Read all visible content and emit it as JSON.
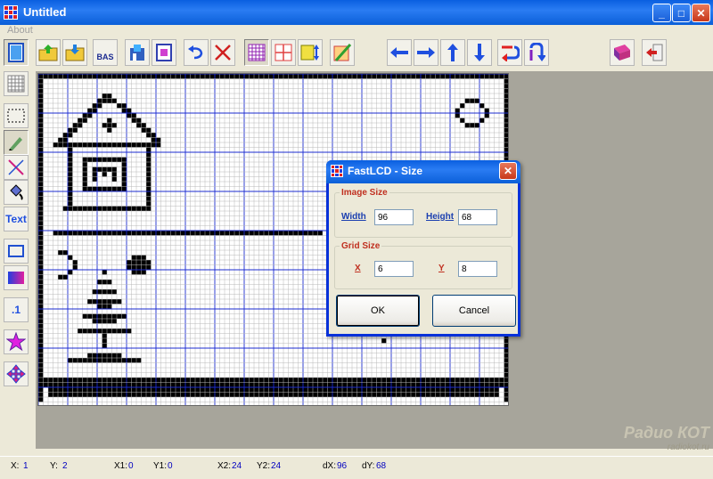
{
  "window": {
    "title": "Untitled",
    "minimize": "_",
    "maximize": "□",
    "close": "✕"
  },
  "menu": {
    "about": "About"
  },
  "toolbar": {
    "new": "new-file-icon",
    "open": "open-folder-icon",
    "save": "save-folder-icon",
    "export_bas": "BAS",
    "import": "import-icon",
    "export": "export-icon",
    "undo": "undo-icon",
    "clear": "clear-icon",
    "grid": "grid-icon",
    "grid2": "grid-lines-icon",
    "resize": "resize-icon",
    "paint": "paint-icon",
    "shift_left": "arrow-left-icon",
    "shift_right": "arrow-right-icon",
    "shift_up": "arrow-up-icon",
    "shift_down": "arrow-down-icon",
    "flip_h": "flip-horizontal-icon",
    "flip_v": "flip-vertical-icon",
    "help": "help-book-icon",
    "exit": "exit-icon"
  },
  "left_tools": {
    "text_label": "Text",
    "dot_label": ".1"
  },
  "status": {
    "x_label": "X:",
    "x_value": "1",
    "y_label": "Y:",
    "y_value": "2",
    "x1_label": "X1:",
    "x1_value": "0",
    "y1_label": "Y1:",
    "y1_value": "0",
    "x2_label": "X2:",
    "x2_value": "24",
    "y2_label": "Y2:",
    "y2_value": "24",
    "dx_label": "dX:",
    "dx_value": "96",
    "dy_label": "dY:",
    "dy_value": "68"
  },
  "dialog": {
    "title": "FastLCD - Size",
    "image_size_legend": "Image Size",
    "width_label": "Width",
    "width_value": "96",
    "height_label": "Height",
    "height_value": "68",
    "grid_size_legend": "Grid Size",
    "x_label": "X",
    "x_value": "6",
    "y_label": "Y",
    "y_value": "8",
    "ok": "OK",
    "cancel": "Cancel",
    "close": "✕"
  },
  "watermark": {
    "line1": "Радио КОТ",
    "line2": "radiokot.ru"
  },
  "colors": {
    "grid_minor": "#b8b8b8",
    "grid_major": "#1b2bd0",
    "pixel": "#000000",
    "accent": "#0a5fe0"
  }
}
